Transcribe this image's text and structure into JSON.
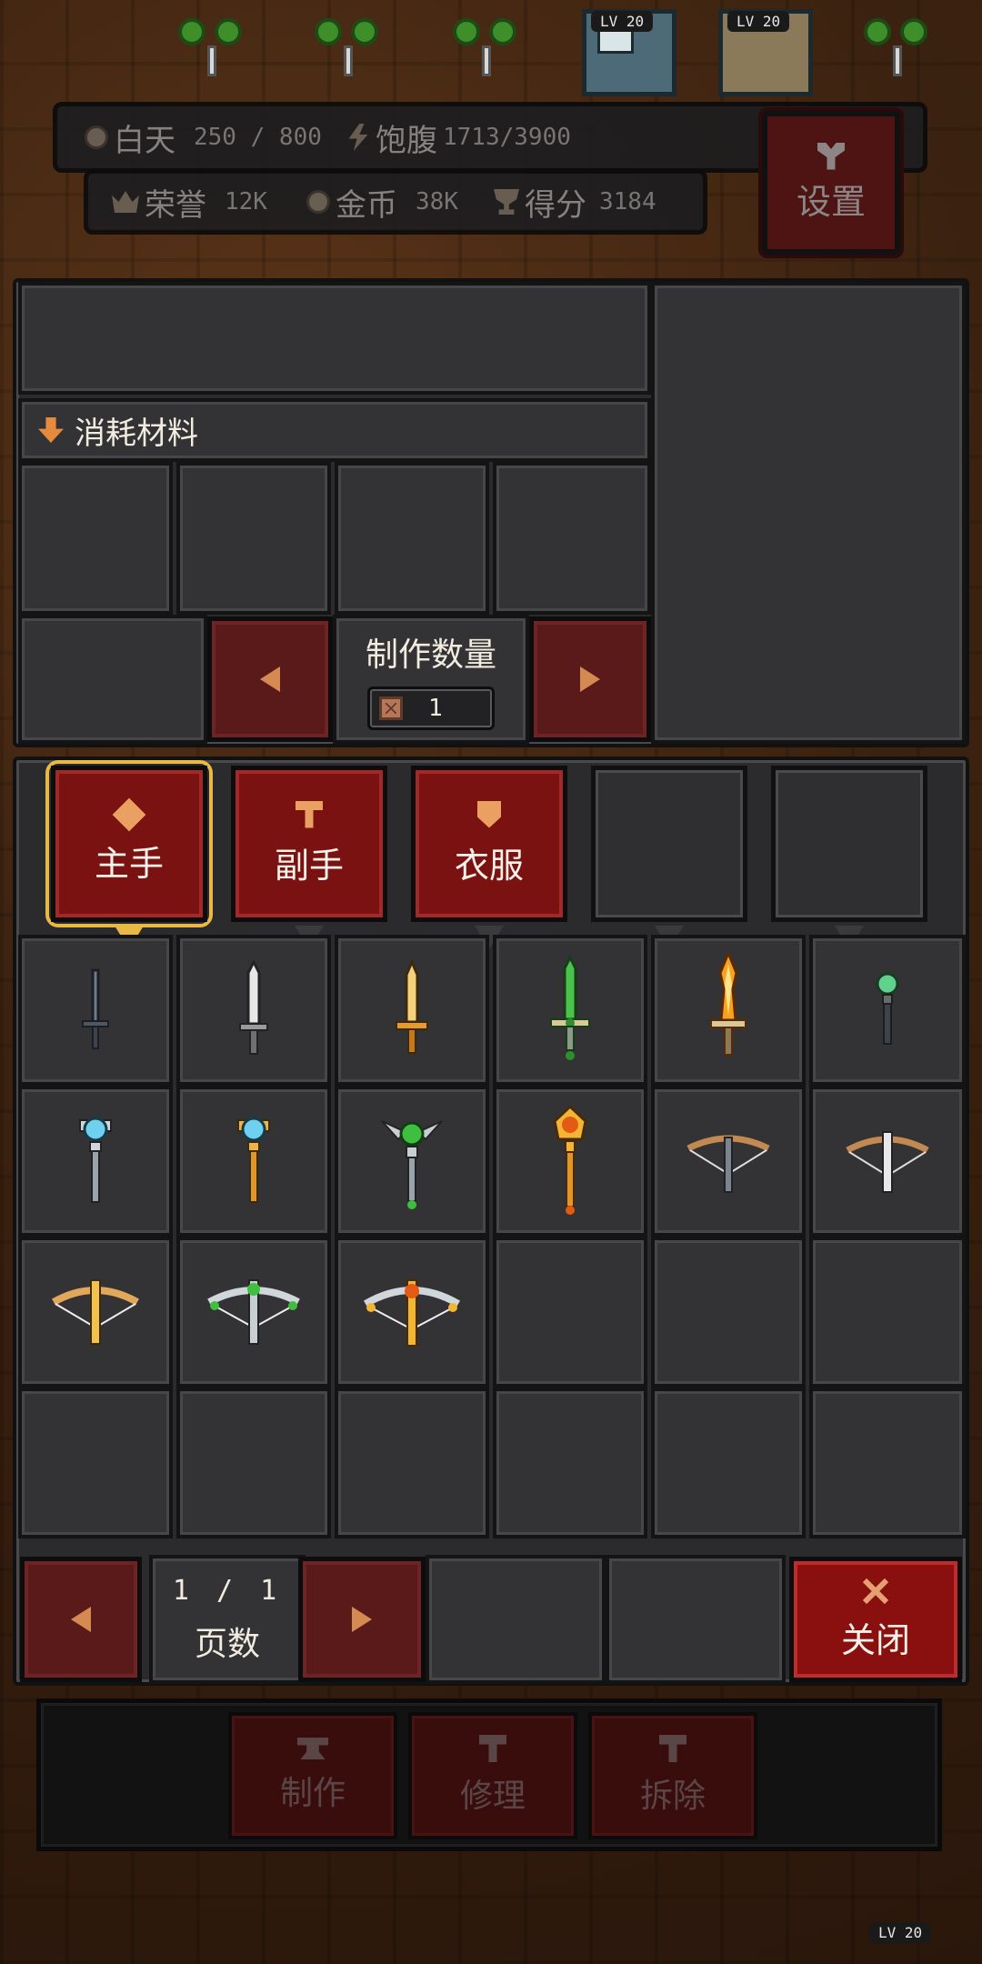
{
  "hud": {
    "day_label": "白天",
    "day_value": "250 / 800",
    "satiety_label": "饱腹",
    "satiety_value": "1713/3900",
    "honor_label": "荣誉",
    "honor_value": "12K",
    "gold_label": "金币",
    "gold_value": "38K",
    "score_label": "得分",
    "score_value": "3184",
    "settings_label": "设置",
    "level_tags": [
      "LV 20",
      "LV 20",
      "LV 20"
    ]
  },
  "crafting": {
    "materials_header": "消耗材料",
    "quantity_label": "制作数量",
    "quantity_value": "1"
  },
  "categories": [
    {
      "label": "主手",
      "icon": "diamond-icon",
      "selected": true
    },
    {
      "label": "副手",
      "icon": "hammer-icon",
      "selected": false
    },
    {
      "label": "衣服",
      "icon": "shield-icon",
      "selected": false
    },
    {
      "label": "",
      "icon": "",
      "selected": false
    },
    {
      "label": "",
      "icon": "",
      "selected": false
    }
  ],
  "items": [
    {
      "icon": "iron-dagger-icon"
    },
    {
      "icon": "steel-sword-icon"
    },
    {
      "icon": "golden-sword-icon"
    },
    {
      "icon": "emerald-sword-icon"
    },
    {
      "icon": "flame-sword-icon"
    },
    {
      "icon": "green-orb-wand-icon"
    },
    {
      "icon": "blue-orb-staff-icon"
    },
    {
      "icon": "golden-blue-staff-icon"
    },
    {
      "icon": "emerald-winged-staff-icon"
    },
    {
      "icon": "amber-staff-icon"
    },
    {
      "icon": "wooden-crossbow-icon"
    },
    {
      "icon": "silver-crossbow-icon"
    },
    {
      "icon": "golden-crossbow-icon"
    },
    {
      "icon": "emerald-crossbow-icon"
    },
    {
      "icon": "flame-crossbow-icon"
    },
    {
      "icon": ""
    },
    {
      "icon": ""
    },
    {
      "icon": ""
    },
    {
      "icon": ""
    },
    {
      "icon": ""
    },
    {
      "icon": ""
    },
    {
      "icon": ""
    },
    {
      "icon": ""
    },
    {
      "icon": ""
    }
  ],
  "pager": {
    "page_text": "1 / 1",
    "page_label": "页数",
    "close_label": "关闭"
  },
  "actions": {
    "craft_label": "制作",
    "repair_label": "修理",
    "dismantle_label": "拆除"
  },
  "colors": {
    "accent_red": "#7a1212",
    "selected_gold": "#e9b946",
    "panel_bg": "#2b2b2d"
  }
}
